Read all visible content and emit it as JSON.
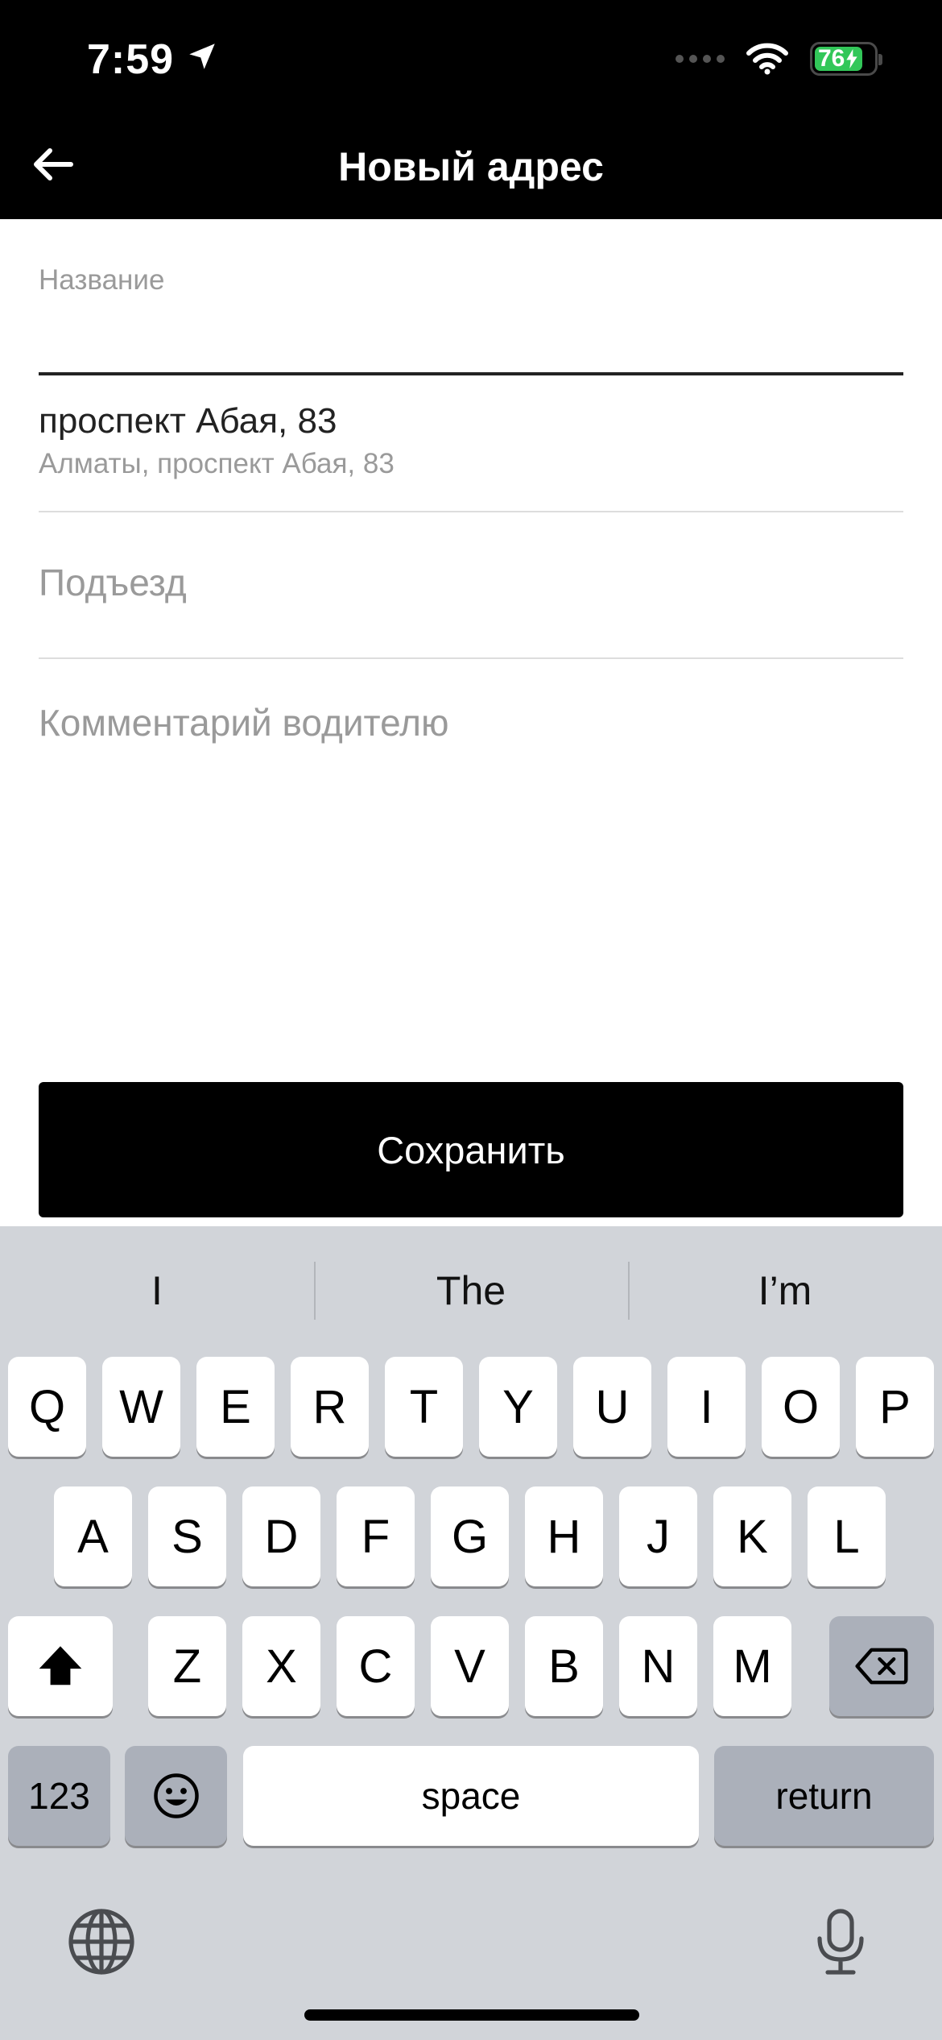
{
  "status_bar": {
    "time": "7:59",
    "battery": "76"
  },
  "header": {
    "title": "Новый адрес"
  },
  "form": {
    "name_label": "Название",
    "name_value": "",
    "address_main": "проспект Абая, 83",
    "address_sub": "Алматы, проспект Абая, 83",
    "entrance_placeholder": "Подъезд",
    "comment_placeholder": "Комментарий водителю",
    "save_label": "Сохранить"
  },
  "keyboard": {
    "suggestions": [
      "I",
      "The",
      "I’m"
    ],
    "row1": [
      "Q",
      "W",
      "E",
      "R",
      "T",
      "Y",
      "U",
      "I",
      "O",
      "P"
    ],
    "row2": [
      "A",
      "S",
      "D",
      "F",
      "G",
      "H",
      "J",
      "K",
      "L"
    ],
    "row3": [
      "Z",
      "X",
      "C",
      "V",
      "B",
      "N",
      "M"
    ],
    "numbers_label": "123",
    "space_label": "space",
    "return_label": "return"
  },
  "icons": {
    "back": "arrow-left-icon",
    "location": "location-arrow-icon",
    "wifi": "wifi-icon",
    "shift": "shift-icon",
    "delete": "backspace-icon",
    "emoji": "emoji-icon",
    "globe": "globe-icon",
    "mic": "microphone-icon"
  },
  "colors": {
    "header_bg": "#000000",
    "battery_green": "#32c759",
    "keyboard_bg": "#d1d4d9",
    "button_bg": "#000000"
  }
}
